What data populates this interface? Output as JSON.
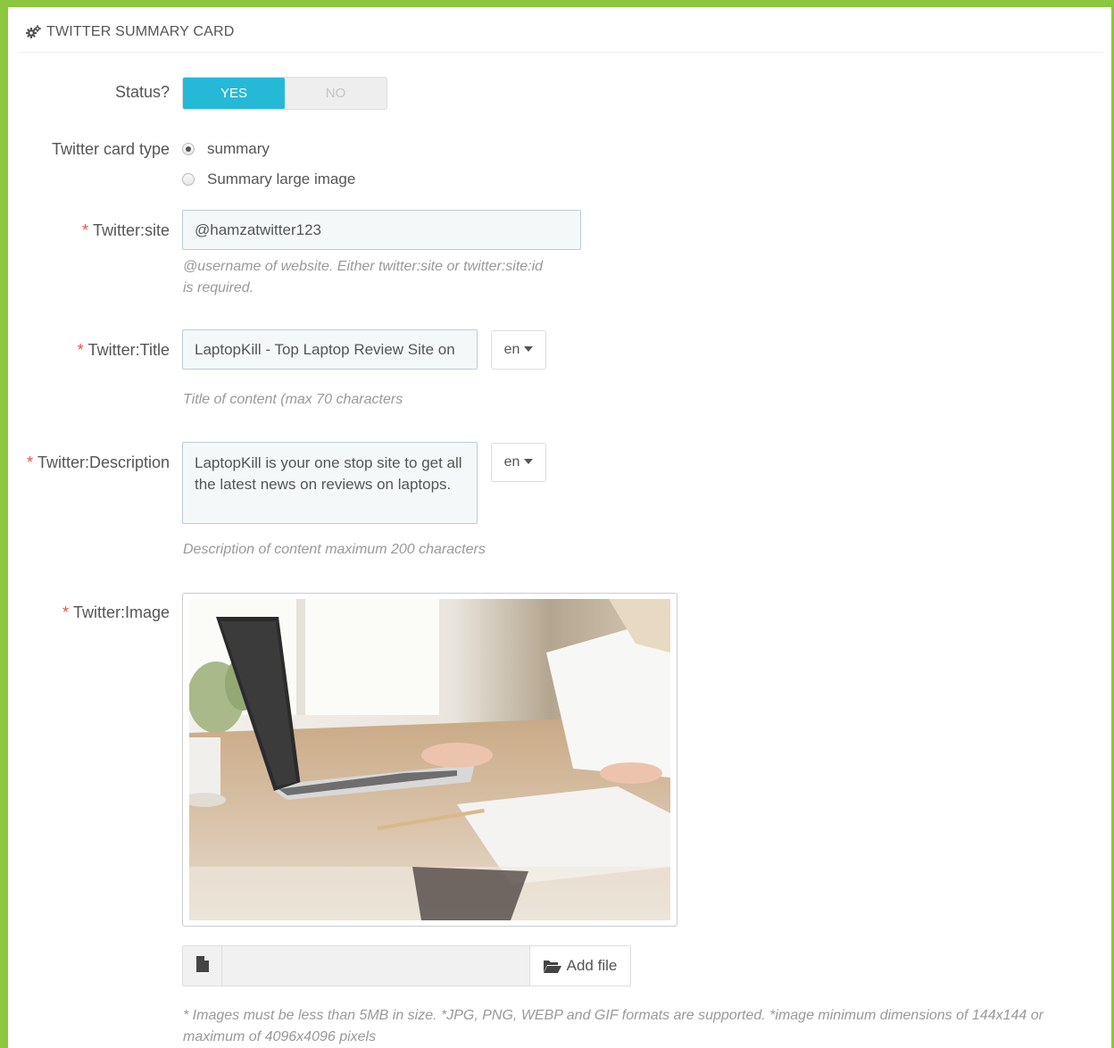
{
  "panel": {
    "title": "TWITTER SUMMARY CARD",
    "icon": "cogs-icon"
  },
  "status": {
    "label": "Status?",
    "yes": "YES",
    "no": "NO",
    "selected": "YES",
    "accent": "#25b9d7"
  },
  "card_type": {
    "label": "Twitter card type",
    "options": [
      {
        "label": "summary",
        "checked": true
      },
      {
        "label": "Summary large image",
        "checked": false
      }
    ]
  },
  "site": {
    "required_mark": "*",
    "label": "Twitter:site",
    "value": "@hamzatwitter123",
    "help_line1": "@username of website. Either twitter:site or twitter:site:id",
    "help_line2": "is required."
  },
  "title": {
    "required_mark": "*",
    "label": "Twitter:Title",
    "value": "LaptopKill - Top Laptop Review Site on",
    "lang": "en",
    "help": "Title of content (max 70 characters"
  },
  "description": {
    "required_mark": "*",
    "label": "Twitter:Description",
    "value": "LaptopKill is your one stop site to get all the latest news on reviews on laptops.",
    "lang": "en",
    "help": "Description of content maximum 200 characters"
  },
  "image": {
    "required_mark": "*",
    "label": "Twitter:Image",
    "add_file": "Add file",
    "help_line1": "* Images must be less than 5MB in size. *JPG, PNG, WEBP and GIF formats are supported. *image minimum dimensions of 144x144 or",
    "help_line2": "maximum of 4096x4096 pixels"
  },
  "colors": {
    "frame": "#8dc63f",
    "required": "#e84e4e",
    "input_bg": "#f5f8f9"
  }
}
